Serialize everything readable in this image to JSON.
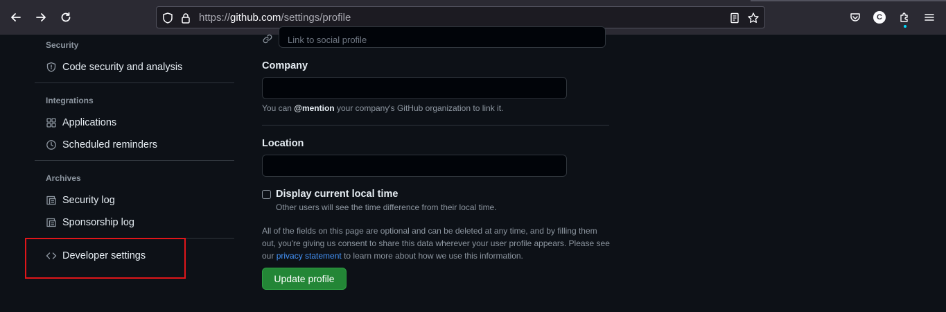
{
  "browser": {
    "url_prefix": "https://",
    "url_host": "github.com",
    "url_path": "/settings/profile",
    "account_initial": "C",
    "icons": {
      "back": "arrow-left-icon",
      "forward": "arrow-right-icon",
      "reload": "reload-icon",
      "tracking": "shield-icon",
      "lock": "lock-icon",
      "reader": "reader-view-icon",
      "bookmark": "star-icon",
      "pocket": "pocket-icon",
      "extensions": "puzzle-icon",
      "menu": "hamburger-menu-icon"
    }
  },
  "sidebar": {
    "sections": [
      {
        "heading": "Security",
        "items": [
          {
            "label": "Code security and analysis",
            "icon": "shield-icon"
          }
        ]
      },
      {
        "heading": "Integrations",
        "items": [
          {
            "label": "Applications",
            "icon": "apps-icon"
          },
          {
            "label": "Scheduled reminders",
            "icon": "clock-icon"
          }
        ]
      },
      {
        "heading": "Archives",
        "items": [
          {
            "label": "Security log",
            "icon": "log-icon"
          },
          {
            "label": "Sponsorship log",
            "icon": "log-icon"
          }
        ]
      }
    ],
    "developer_settings": {
      "label": "Developer settings",
      "icon": "code-icon"
    },
    "highlight_color": "#e0161a"
  },
  "form": {
    "social_placeholder": "Link to social profile",
    "company": {
      "label": "Company",
      "value": "",
      "note_prefix": "You can ",
      "note_mention": "@mention",
      "note_suffix": " your company's GitHub organization to link it."
    },
    "location": {
      "label": "Location",
      "value": ""
    },
    "local_time": {
      "label": "Display current local time",
      "hint": "Other users will see the time difference from their local time.",
      "checked": false
    },
    "disclaimer": {
      "before": "All of the fields on this page are optional and can be deleted at any time, and by filling them out, you're giving us consent to share this data wherever your user profile appears. Please see our ",
      "link": "privacy statement",
      "after": " to learn more about how we use this information."
    },
    "submit_label": "Update profile"
  },
  "colors": {
    "background": "#0d1117",
    "primary_button": "#238636",
    "link": "#4493f8"
  }
}
